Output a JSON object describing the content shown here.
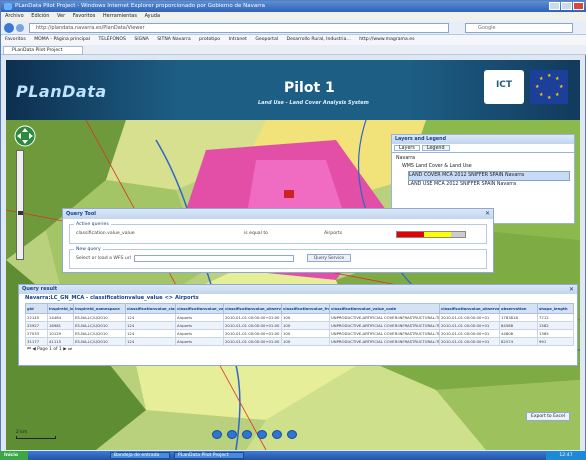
{
  "window": {
    "title": "PLanData Pilot Project - Windows Internet Explorer proporcionado por Gobierno de Navarra",
    "menu": [
      "Archivo",
      "Edición",
      "Ver",
      "Favoritos",
      "Herramientas",
      "Ayuda"
    ],
    "url": "http://plandata.navarra.es/PlanData/Viewer",
    "search_placeholder": "Google",
    "favorites": [
      "Favoritos",
      "MOMA - Página principal",
      "TELÉFONOS",
      "SIGNA",
      "SITNA Navarra",
      "prototipo",
      "Intranet",
      "Geoportal",
      "Desarrollo Rural, Industria...",
      "http://www.magrama.es"
    ],
    "tab_label": "PLanData Pilot Project"
  },
  "banner": {
    "logo": "PLanData",
    "logo_sub": "",
    "pilot_title": "Pilot 1",
    "pilot_subtitle": "Land Use - Land Cover Analysis System",
    "ict_logo": "ICT"
  },
  "layers_panel": {
    "title": "Layers and Legend",
    "tabs": [
      "Layers",
      "Legend"
    ],
    "tree": [
      "Navarra",
      "WMS Land Cover & Land Use",
      "LAND COVER MCA 2012 SNIFFER SPAIN Navarra",
      "LAND USE MCA 2012 SNIFFER SPAIN Navarra"
    ]
  },
  "query_tool": {
    "title": "Query Tool",
    "active_legend": "Active queries",
    "active_field": "classification.value_value",
    "active_operator": "is equal to",
    "active_value": "Airports",
    "new_legend": "New query",
    "new_prompt": "Select or load a WFS url",
    "new_button": "Query Service",
    "color_bar": [
      "#e60000",
      "#ffff00",
      "#cccccc"
    ]
  },
  "query_result": {
    "title": "Query result",
    "table_title": "Navarra:LC_GN_MCA - classificationvalue_value <> Airports",
    "columns": [
      "gid",
      "inspireid_localid",
      "inspireid_namespace",
      "classificationvalue_classificationvalue",
      "classificationvalue_value",
      "classificationvalue_observationdate",
      "classificationvalue_fraction",
      "classificationvalue_value_code",
      "classificationvalue_observationdate_2",
      "observation",
      "shape_length"
    ],
    "rows": [
      [
        "22145",
        "14464",
        "ES-NA-LC/U/2010",
        "124",
        "Airports",
        "2010-01-01 00:00:00+01:00",
        "100",
        "UNPRODUCTIVE-ARTIFICIAL COVER:INFRASTRUCTURAL:TRANSPORTS:AIRPORTS",
        "2010-01-01 00:00:00+01",
        "1783818",
        "7712"
      ],
      [
        "25927",
        "16981",
        "ES-NA-LC/U/2010",
        "124",
        "Airports",
        "2010-01-01 00:00:00+01:00",
        "100",
        "UNPRODUCTIVE-ARTIFICIAL COVER:INFRASTRUCTURAL:TRANSPORTS:AIRPORTS",
        "2010-01-01 00:00:00+01",
        "84568",
        "1582"
      ],
      [
        "27033",
        "10129",
        "ES-NA-LC/U/2010",
        "124",
        "Airports",
        "2010-01-01 00:00:00+01:00",
        "100",
        "UNPRODUCTIVE-ARTIFICIAL COVER:INFRASTRUCTURAL:TRANSPORTS:AIRPORTS",
        "2010-01-01 00:00:00+01",
        "44808",
        "1365"
      ],
      [
        "31177",
        "41115",
        "ES-NA-LC/U/2010",
        "124",
        "Airports",
        "2010-01-01 00:00:00+01:00",
        "100",
        "UNPRODUCTIVE-ARTIFICIAL COVER:INFRASTRUCTURAL:TRANSPORTS:AIRPORTS",
        "2010-01-01 00:00:00+01",
        "82574",
        "991"
      ]
    ],
    "pager": "Page 1 of 1",
    "export_button": "Export to Excel"
  },
  "map": {
    "scale_label": "2 km"
  },
  "taskbar": {
    "start": "Inicio",
    "apps": [
      "Bandeja de entrada",
      "PLanData Pilot Project"
    ],
    "clock": "12:47"
  }
}
